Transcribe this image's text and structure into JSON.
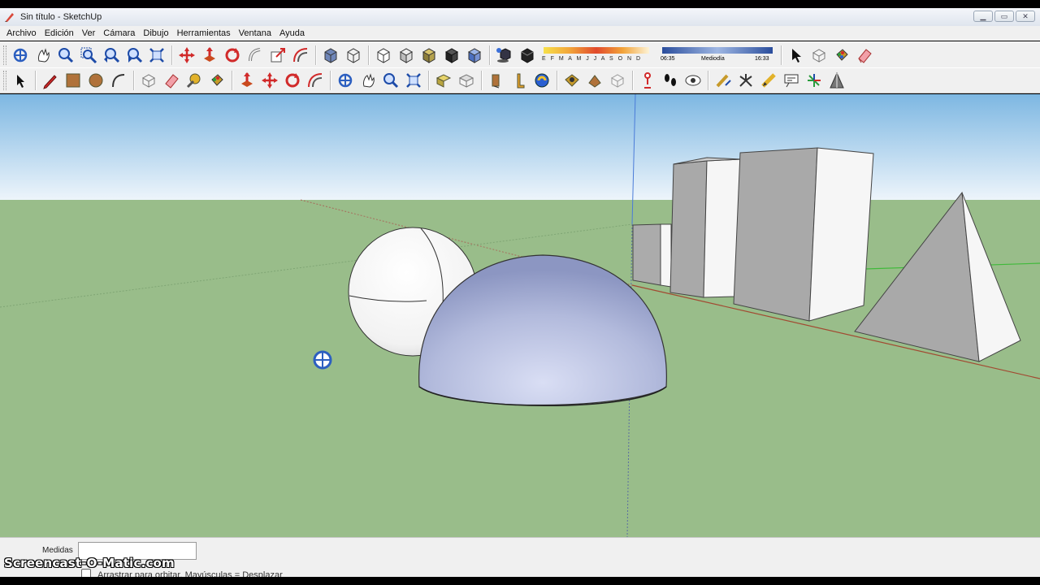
{
  "window": {
    "title": "Sin título - SketchUp",
    "controls": [
      "minimize",
      "maximize",
      "close"
    ]
  },
  "menu": {
    "items": [
      "Archivo",
      "Edición",
      "Ver",
      "Cámara",
      "Dibujo",
      "Herramientas",
      "Ventana",
      "Ayuda"
    ]
  },
  "toolbar_row1": {
    "icons": [
      "orbit-icon",
      "pan-icon",
      "zoom-icon",
      "zoom-window-icon",
      "previous-view-icon",
      "next-view-icon",
      "zoom-extents-icon",
      "move-icon",
      "push-pull-icon",
      "rotate-icon",
      "follow-me-icon",
      "scale-icon",
      "offset-icon",
      "xray-icon",
      "wireframe-icon",
      "hidden-line-icon",
      "shaded-icon",
      "shaded-textures-icon",
      "monochrome-icon",
      "shadows-icon",
      "fog-icon",
      "select-icon",
      "make-component-icon",
      "paint-bucket-icon",
      "eraser-icon"
    ]
  },
  "shadow_settings": {
    "months": "E F M A M J J A S O N D",
    "time_start": "06:35",
    "time_mid": "Mediodía",
    "time_end": "16:33"
  },
  "toolbar_row2": {
    "icons": [
      "select-icon",
      "pencil-icon",
      "rectangle-icon",
      "circle-icon",
      "arc-icon",
      "make-component-icon",
      "eraser-icon",
      "tape-measure-icon",
      "paint-bucket-icon",
      "push-pull-icon",
      "move-icon",
      "rotate-icon",
      "follow-me-icon",
      "orbit-icon",
      "pan-icon",
      "zoom-icon",
      "zoom-extents-icon",
      "previous-icon",
      "next-icon",
      "top-view-icon",
      "iso-view-icon",
      "front-view-icon",
      "right-view-icon",
      "back-view-icon",
      "left-view-icon",
      "bottom-view-icon",
      "position-camera-icon",
      "walk-icon",
      "look-around-icon",
      "dimensions-icon",
      "protractor-icon",
      "text-icon",
      "axes-icon",
      "3d-text-icon",
      "section-plane-icon"
    ]
  },
  "status": {
    "measures_label": "Medidas",
    "hint": "Arrastrar para orbitar. Mayúsculas = Desplazar",
    "watermark": "Screencast-O-Matic.com"
  },
  "colors": {
    "sky_top": "#7db7e2",
    "sky_bottom": "#e8f2fa",
    "ground": "#99bd8a",
    "dome": "#a9b3d6",
    "sphere": "#f4f4f4",
    "box_shade": "#a9a9a9",
    "box_light": "#f6f6f6"
  }
}
